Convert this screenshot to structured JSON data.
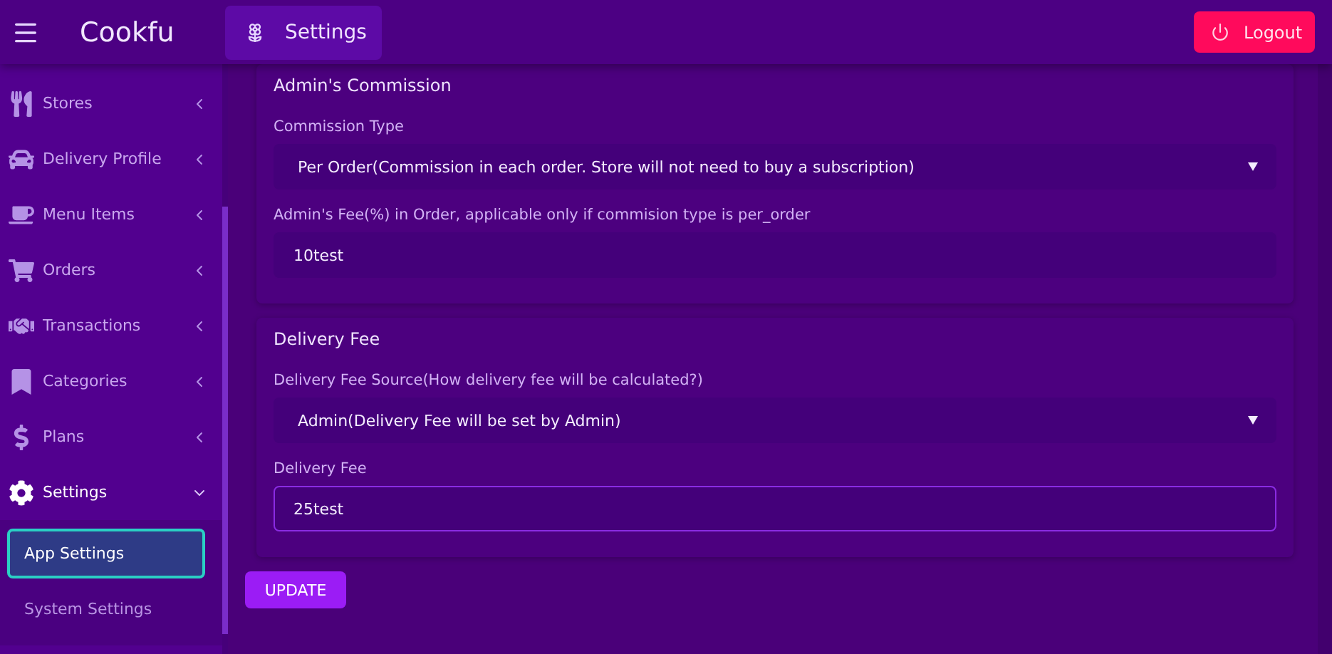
{
  "header": {
    "brand": "Cookfu",
    "page_title": "Settings",
    "logout": "Logout"
  },
  "sidebar": {
    "items": [
      {
        "label": "Stores",
        "expanded": false
      },
      {
        "label": "Delivery Profile",
        "expanded": false
      },
      {
        "label": "Menu Items",
        "expanded": false
      },
      {
        "label": "Orders",
        "expanded": false
      },
      {
        "label": "Transactions",
        "expanded": false
      },
      {
        "label": "Categories",
        "expanded": false
      },
      {
        "label": "Plans",
        "expanded": false
      },
      {
        "label": "Settings",
        "expanded": true,
        "children": [
          {
            "label": "App Settings",
            "selected": true
          },
          {
            "label": "System Settings",
            "selected": false
          }
        ]
      }
    ]
  },
  "sections": [
    {
      "title": "Admin's Commission",
      "fields": [
        {
          "kind": "select",
          "label": "Commission Type",
          "value": "Per Order(Commission in each order. Store will not need to buy a subscription)",
          "focused": false
        },
        {
          "kind": "input",
          "label": "Admin's Fee(%) in Order, applicable only if commision type is per_order",
          "value": "10test",
          "focused": false
        }
      ]
    },
    {
      "title": "Delivery Fee",
      "fields": [
        {
          "kind": "select",
          "label": "Delivery Fee Source(How delivery fee will be calculated?)",
          "value": "Admin(Delivery Fee will be set by Admin)",
          "focused": false
        },
        {
          "kind": "input",
          "label": "Delivery Fee",
          "value": "25test",
          "focused": true
        }
      ]
    }
  ],
  "update_button": "UPDATE"
}
